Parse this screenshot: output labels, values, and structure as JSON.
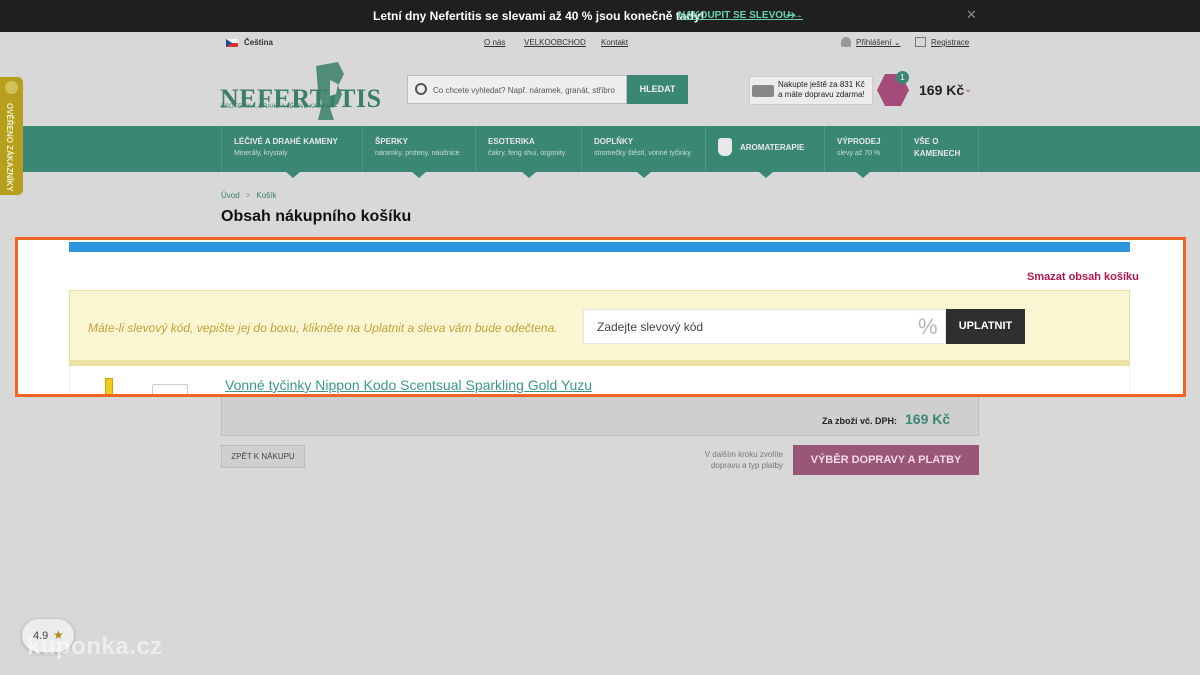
{
  "promo": {
    "text": "Letní dny Nefertitis se slevami až 40 % jsou konečně tady!",
    "link": "NAKOUPIT SE SLEVOU →",
    "arrow": "➔",
    "close": "✕"
  },
  "toplinks": {
    "language": "Čeština",
    "about": "O nás",
    "wholesale": "VELKOOBCHOD",
    "contact": "Kontakt",
    "login": "Přihlášení ⌄",
    "register": "Registrace"
  },
  "header": {
    "logo": "NEFERTITIS",
    "logo_sub": "ESOTERIKA, DRAHÉ A LÉČIVÉ KAMENY",
    "search_placeholder": "Co chcete vyhledat? Např. náramek, granát, stříbro",
    "search_button": "HLEDAT",
    "shipping_line1": "Nakupte ještě za 831 Kč",
    "shipping_line2": "a máte dopravu zdarma!",
    "cart_count": "1",
    "cart_price": "169 Kč",
    "cart_chevron": "⌄"
  },
  "nav": [
    {
      "title": "LÉČIVÉ A DRAHÉ KAMENY",
      "sub": "Minerály, krystaly"
    },
    {
      "title": "ŠPERKY",
      "sub": "náramky, prsteny, náušnice"
    },
    {
      "title": "ESOTERIKA",
      "sub": "čakry, feng shui, orgonity"
    },
    {
      "title": "DOPLŇKY",
      "sub": "stromečky štěstí, vonné tyčinky"
    },
    {
      "title": "AROMATERAPIE",
      "sub": ""
    },
    {
      "title": "VÝPRODEJ",
      "sub": "slevy až 70 %"
    },
    {
      "title": "VŠE O",
      "sub": "KAMENECH"
    }
  ],
  "breadcrumb": {
    "home": "Úvod",
    "sep": ">",
    "current": "Košík"
  },
  "page_title": "Obsah nákupního košíku",
  "cart": {
    "clear": "Smazat obsah košíku",
    "coupon_text": "Máte-li slevový kód, vepište jej do boxu, klikněte na Uplatnit a sleva vám bude odečtena.",
    "coupon_placeholder": "Zadejte slevový kód",
    "coupon_percent": "%",
    "coupon_button": "UPLATNIT",
    "product_name": "Vonné tyčinky Nippon Kodo Scentsual Sparkling Gold Yuzu",
    "total_label": "Za zboží vč. DPH:",
    "total_value": "169 Kč",
    "back_button": "ZPĚT K NÁKUPU",
    "next_note": "V dalším kroku zvolíte dopravu a typ platby",
    "next_button": "VÝBĚR DOPRAVY A PLATBY"
  },
  "side_tab": "OVĚŘENO ZÁKAZNÍKY",
  "rating": {
    "value": "4.9",
    "star": "★"
  },
  "watermark": "kuponka.cz",
  "colors": {
    "accent": "#3a8874",
    "highlight": "#f26522",
    "brand_pink": "#a44b7a",
    "blue_bar": "#2b96dd"
  }
}
